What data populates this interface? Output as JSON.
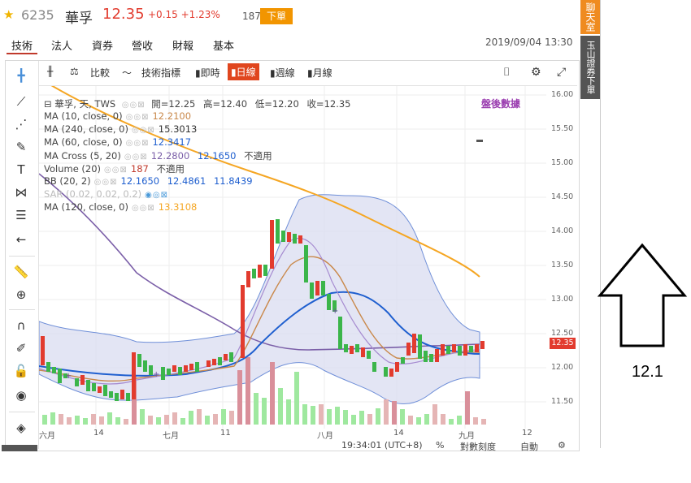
{
  "quote": {
    "code": "6235",
    "name": "華孚",
    "price": "12.35",
    "change": "+0.15 +1.23%",
    "volume": "187張",
    "order_label": "下單"
  },
  "tabs": [
    "技術",
    "法人",
    "資券",
    "營收",
    "財報",
    "基本"
  ],
  "datetime": "2019/09/04 13:30",
  "toolbar": {
    "compare": "比較",
    "indicators": "技術指標",
    "realtime": "即時",
    "daily": "日線",
    "weekly": "週線",
    "monthly": "月線"
  },
  "legend": {
    "main": "華孚, 天, TWS",
    "open_label": "開=12.25",
    "high_label": "高=12.40",
    "low_label": "低=12.20",
    "close_label": "收=12.35",
    "ma10": "MA (10, close, 0)",
    "ma10_val": "12.2100",
    "ma240": "MA (240, close, 0)",
    "ma240_val": "15.3013",
    "ma60": "MA (60, close, 0)",
    "ma60_val": "12.3417",
    "macross": "MA Cross (5, 20)",
    "macross_v1": "12.2800",
    "macross_v2": "12.1650",
    "macross_v3": "不適用",
    "volume": "Volume (20)",
    "volume_v1": "187",
    "volume_v2": "不適用",
    "bb": "BB (20, 2)",
    "bb_v1": "12.1650",
    "bb_v2": "12.4861",
    "bb_v3": "11.8439",
    "sar": "SAR (0.02, 0.02, 0.2)",
    "ma120": "MA (120, close, 0)",
    "ma120_val": "13.3108",
    "post_market": "盤後數據"
  },
  "yaxis": [
    "16.00",
    "15.50",
    "15.00",
    "14.50",
    "14.00",
    "13.50",
    "13.00",
    "12.50",
    "12.00",
    "11.50"
  ],
  "xaxis": [
    "六月",
    "14",
    "七月",
    "11",
    "八月",
    "14",
    "九月",
    "12"
  ],
  "current_price_tag": "12.35",
  "bottom_bar": {
    "time": "19:34:01 (UTC+8)",
    "percent": "%",
    "log": "對數刻度",
    "auto": "自動"
  },
  "side": {
    "chat": "聊天室",
    "broker": "玉山證券下單"
  },
  "annotation": "12.1",
  "colors": {
    "up": "#e23b2e",
    "down": "#3bb54a",
    "accent": "#e0461e",
    "bb_fill": "#d9dcf0",
    "ma_blue": "#1f5fcf",
    "ma_orange": "#f5a623",
    "ma_purple": "#6b4f9e",
    "ma_brown": "#c9884a"
  }
}
